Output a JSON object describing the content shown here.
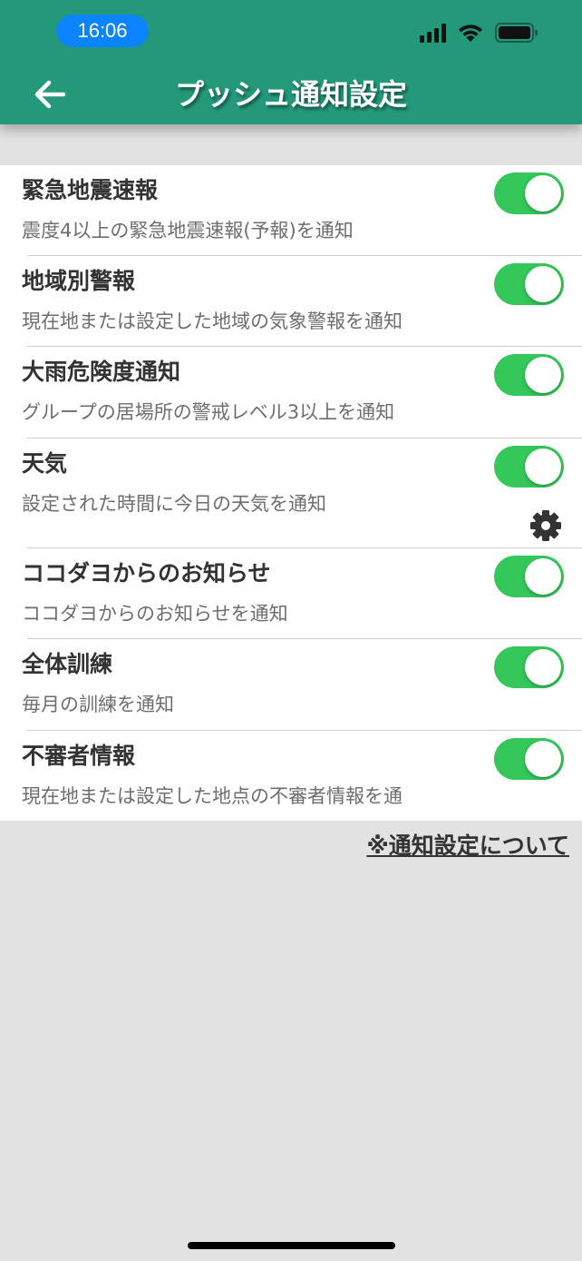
{
  "status_bar": {
    "time": "16:06"
  },
  "header": {
    "title": "プッシュ通知設定"
  },
  "settings": [
    {
      "title": "緊急地震速報",
      "description": "震度4以上の緊急地震速報(予報)を通知",
      "enabled": true
    },
    {
      "title": "地域別警報",
      "description": "現在地または設定した地域の気象警報を通知",
      "enabled": true
    },
    {
      "title": "大雨危険度通知",
      "description": "グループの居場所の警戒レベル3以上を通知",
      "enabled": true
    },
    {
      "title": "天気",
      "description": "設定された時間に今日の天気を通知",
      "enabled": true,
      "has_settings_icon": true
    },
    {
      "title": "ココダヨからのお知らせ",
      "description": "ココダヨからのお知らせを通知",
      "enabled": true
    },
    {
      "title": "全体訓練",
      "description": "毎月の訓練を通知",
      "enabled": true
    },
    {
      "title": "不審者情報",
      "description": "現在地または設定した地点の不審者情報を通",
      "enabled": true
    }
  ],
  "footer": {
    "about_link": "※通知設定について"
  },
  "colors": {
    "header_bg": "#24997a",
    "toggle_on": "#34c759",
    "time_pill": "#0a84ff",
    "page_bg": "#e2e2e2"
  }
}
